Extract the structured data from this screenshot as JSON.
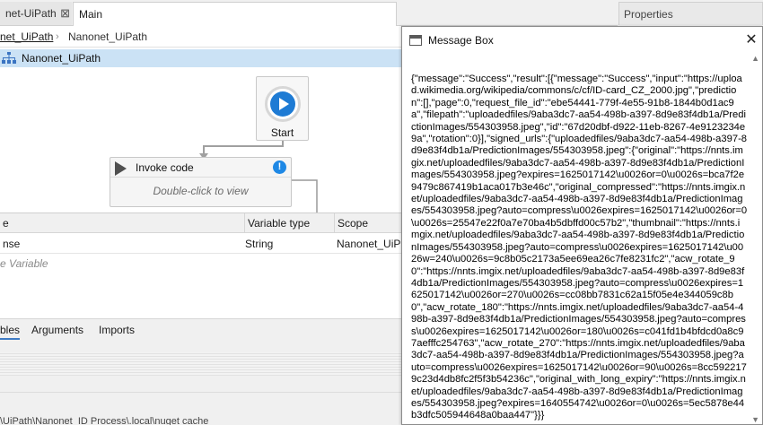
{
  "tabs": {
    "tab1_label": "net-UiPath",
    "tab1_close": "⊠",
    "tab2_label": "Main",
    "properties_label": "Properties"
  },
  "breadcrumb": {
    "item1": "net_UiPath",
    "separator": "›",
    "item2": "Nanonet_UiPath"
  },
  "designer": {
    "sequence_title": "Nanonet_UiPath",
    "start_label": "Start",
    "invoke_title": "Invoke code",
    "invoke_hint": "Double-click to view",
    "invoke_warning": "!"
  },
  "variables": {
    "headers": {
      "name": "e",
      "type": "Variable type",
      "scope": "Scope"
    },
    "rows": [
      {
        "name": "nse",
        "type": "String",
        "scope": "Nanonet_UiP"
      }
    ],
    "create_hint": "e Variable"
  },
  "bottom_tabs": [
    "bles",
    "Arguments",
    "Imports"
  ],
  "status_path": "\\UiPath\\Nanonet_ID Process\\.local\\nuget cache",
  "message_box": {
    "title": "Message Box",
    "close": "✕",
    "text": "{\"message\":\"Success\",\"result\":[{\"message\":\"Success\",\"input\":\"https://upload.wikimedia.org/wikipedia/commons/c/cf/ID-card_CZ_2000.jpg\",\"prediction\":[],\"page\":0,\"request_file_id\":\"ebe54441-779f-4e55-91b8-1844b0d1ac9a\",\"filepath\":\"uploadedfiles/9aba3dc7-aa54-498b-a397-8d9e83f4db1a/PredictionImages/554303958.jpeg\",\"id\":\"67d20dbf-d922-11eb-8267-4e9123234e9a\",\"rotation\":0}],\"signed_urls\":{\"uploadedfiles/9aba3dc7-aa54-498b-a397-8d9e83f4db1a/PredictionImages/554303958.jpeg\":{\"original\":\"https://nnts.imgix.net/uploadedfiles/9aba3dc7-aa54-498b-a397-8d9e83f4db1a/PredictionImages/554303958.jpeg?expires=1625017142\\u0026or=0\\u0026s=bca7f2e9479c867419b1aca017b3e46c\",\"original_compressed\":\"https://nnts.imgix.net/uploadedfiles/9aba3dc7-aa54-498b-a397-8d9e83f4db1a/PredictionImages/554303958.jpeg?auto=compress\\u0026expires=1625017142\\u0026or=0\\u0026s=25547e22f0a7e70ba4b5dbffd00c57b2\",\"thumbnail\":\"https://nnts.imgix.net/uploadedfiles/9aba3dc7-aa54-498b-a397-8d9e83f4db1a/PredictionImages/554303958.jpeg?auto=compress\\u0026expires=1625017142\\u0026w=240\\u0026s=9c8b05c2173a5ee69ea26c7fe8231fc2\",\"acw_rotate_90\":\"https://nnts.imgix.net/uploadedfiles/9aba3dc7-aa54-498b-a397-8d9e83f4db1a/PredictionImages/554303958.jpeg?auto=compress\\u0026expires=1625017142\\u0026or=270\\u0026s=cc08bb7831c62a15f05e4e344059c8b0\",\"acw_rotate_180\":\"https://nnts.imgix.net/uploadedfiles/9aba3dc7-aa54-498b-a397-8d9e83f4db1a/PredictionImages/554303958.jpeg?auto=compress\\u0026expires=1625017142\\u0026or=180\\u0026s=c041fd1b4bfdcd0a8c97aefffc254763\",\"acw_rotate_270\":\"https://nnts.imgix.net/uploadedfiles/9aba3dc7-aa54-498b-a397-8d9e83f4db1a/PredictionImages/554303958.jpeg?auto=compress\\u0026expires=1625017142\\u0026or=90\\u0026s=8cc5922179c23d4db8fc2f5f3b54236c\",\"original_with_long_expiry\":\"https://nnts.imgix.net/uploadedfiles/9aba3dc7-aa54-498b-a397-8d9e83f4db1a/PredictionImages/554303958.jpeg?expires=1640554742\\u0026or=0\\u0026s=5ec5878e44b3dfc505944648a0baa447\"}}}"
  },
  "colors": {
    "accent_blue": "#1e88e5",
    "sequence_header": "#cbe2f5",
    "play_blue": "#1e7bd4"
  },
  "icons": [
    "sequence-icon",
    "play-icon",
    "warning-icon",
    "window-icon",
    "close-icon"
  ]
}
